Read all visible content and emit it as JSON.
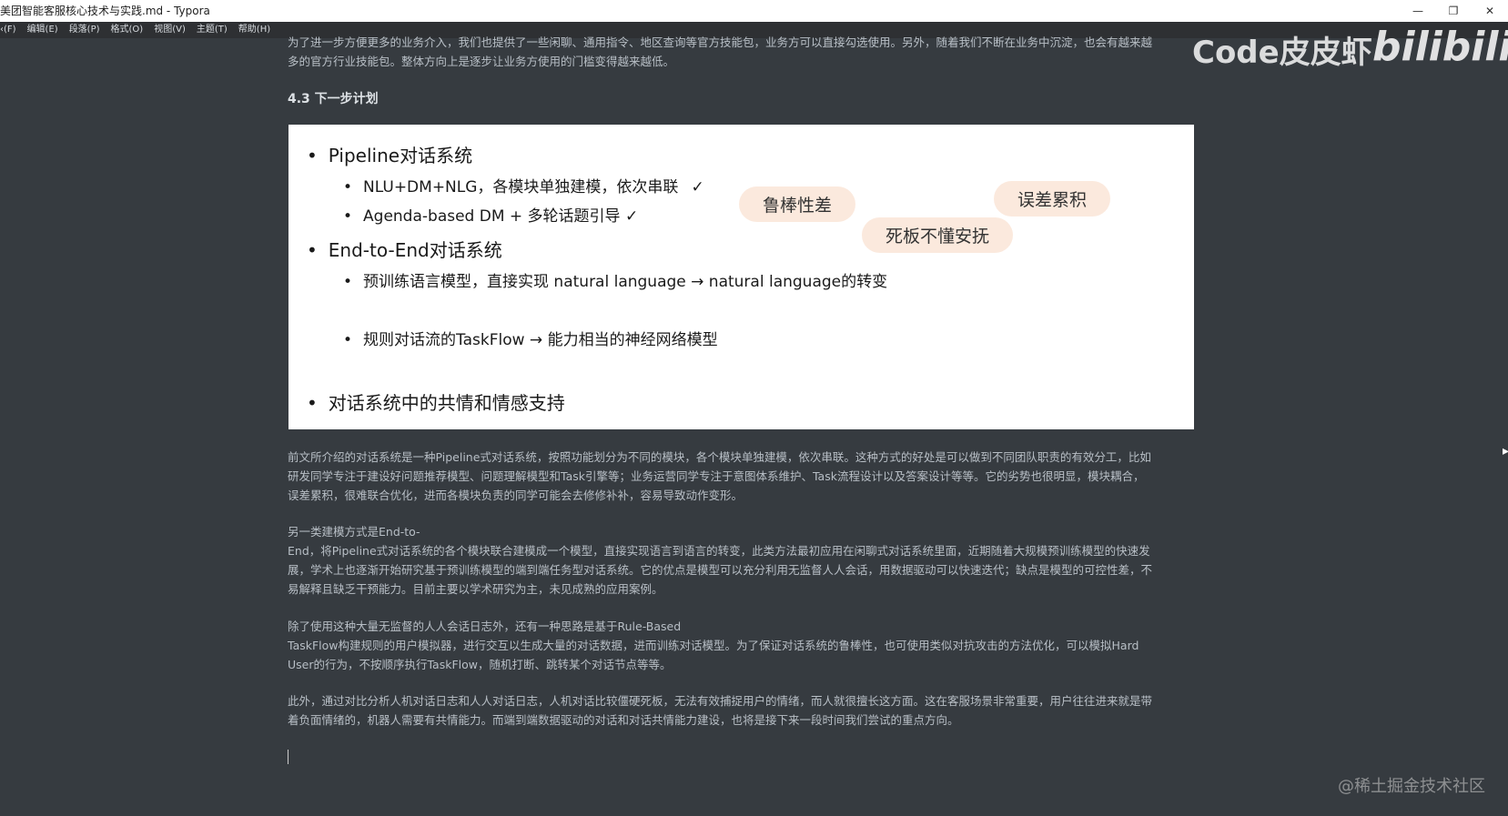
{
  "window": {
    "title": "美团智能客服核心技术与实践.md - Typora",
    "controls": [
      "—",
      "❐",
      "✕"
    ]
  },
  "menu": [
    "‹(F)",
    "编辑(E)",
    "段落(P)",
    "格式(O)",
    "视图(V)",
    "主题(T)",
    "帮助(H)"
  ],
  "intro": [
    "为了进一步方便更多的业务介入，我们也提供了一些闲聊、通用指令、地区查询等官方技能包，业务方可以直接勾选使用。另外，随着我们不断在业务中沉淀，也会有越来越",
    "多的官方行业技能包。整体方向上是逐步让业务方使用的门槛变得越来越低。"
  ],
  "heading": "4.3 下一步计划",
  "slide": {
    "pipeline": "Pipeline对话系统",
    "pipeline_sub1": "NLU+DM+NLG，各模块单独建模，依次串联",
    "pipeline_sub1_check": "✓",
    "pipeline_sub2": "Agenda-based DM + 多轮话题引导 ✓",
    "e2e": "End-to-End对话系统",
    "e2e_sub1": "预训练语言模型，直接实现 natural language → natural language的转变",
    "e2e_sub2": "规则对话流的TaskFlow → 能力相当的神经网络模型",
    "empathy": "对话系统中的共情和情感支持",
    "note_robust": "鲁棒性差",
    "note_error": "误差累积",
    "note_rigid": "死板不懂安抚"
  },
  "paragraphs": [
    [
      "前文所介绍的对话系统是一种Pipeline式对话系统，按照功能划分为不同的模块，各个模块单独建模，依次串联。这种方式的好处是可以做到不同团队职责的有效分工，比如",
      "研发同学专注于建设好问题推荐模型、问题理解模型和Task引擎等；业务运营同学专注于意图体系维护、Task流程设计以及答案设计等等。它的劣势也很明显，模块耦合，",
      "误差累积，很难联合优化，进而各模块负责的同学可能会去修修补补，容易导致动作变形。"
    ],
    [
      "另一类建模方式是End-to-",
      "End，将Pipeline式对话系统的各个模块联合建模成一个模型，直接实现语言到语言的转变，此类方法最初应用在闲聊式对话系统里面，近期随着大规模预训练模型的快速发",
      "展，学术上也逐渐开始研究基于预训练模型的端到端任务型对话系统。它的优点是模型可以充分利用无监督人人会话，用数据驱动可以快速迭代；缺点是模型的可控性差，不",
      "易解释且缺乏干预能力。目前主要以学术研究为主，未见成熟的应用案例。"
    ],
    [
      "除了使用这种大量无监督的人人会话日志外，还有一种思路是基于Rule-Based",
      "TaskFlow构建规则的用户模拟器，进行交互以生成大量的对话数据，进而训练对话模型。为了保证对话系统的鲁棒性，也可使用类似对抗攻击的方法优化，可以模拟Hard",
      "User的行为，不按顺序执行TaskFlow，随机打断、跳转某个对话节点等等。"
    ],
    [
      "此外，通过对比分析人机对话日志和人人对话日志，人机对话比较僵硬死板，无法有效捕捉用户的情绪，而人就很擅长这方面。这在客服场景非常重要，用户往往进来就是带",
      "着负面情绪的，机器人需要有共情能力。而端到端数据驱动的对话和对话共情能力建设，也将是接下来一段时间我们尝试的重点方向。"
    ]
  ],
  "overlay": {
    "uploader": "Code皮皮虾",
    "site_logo": "bilibili",
    "community": "@稀土掘金技术社区"
  }
}
